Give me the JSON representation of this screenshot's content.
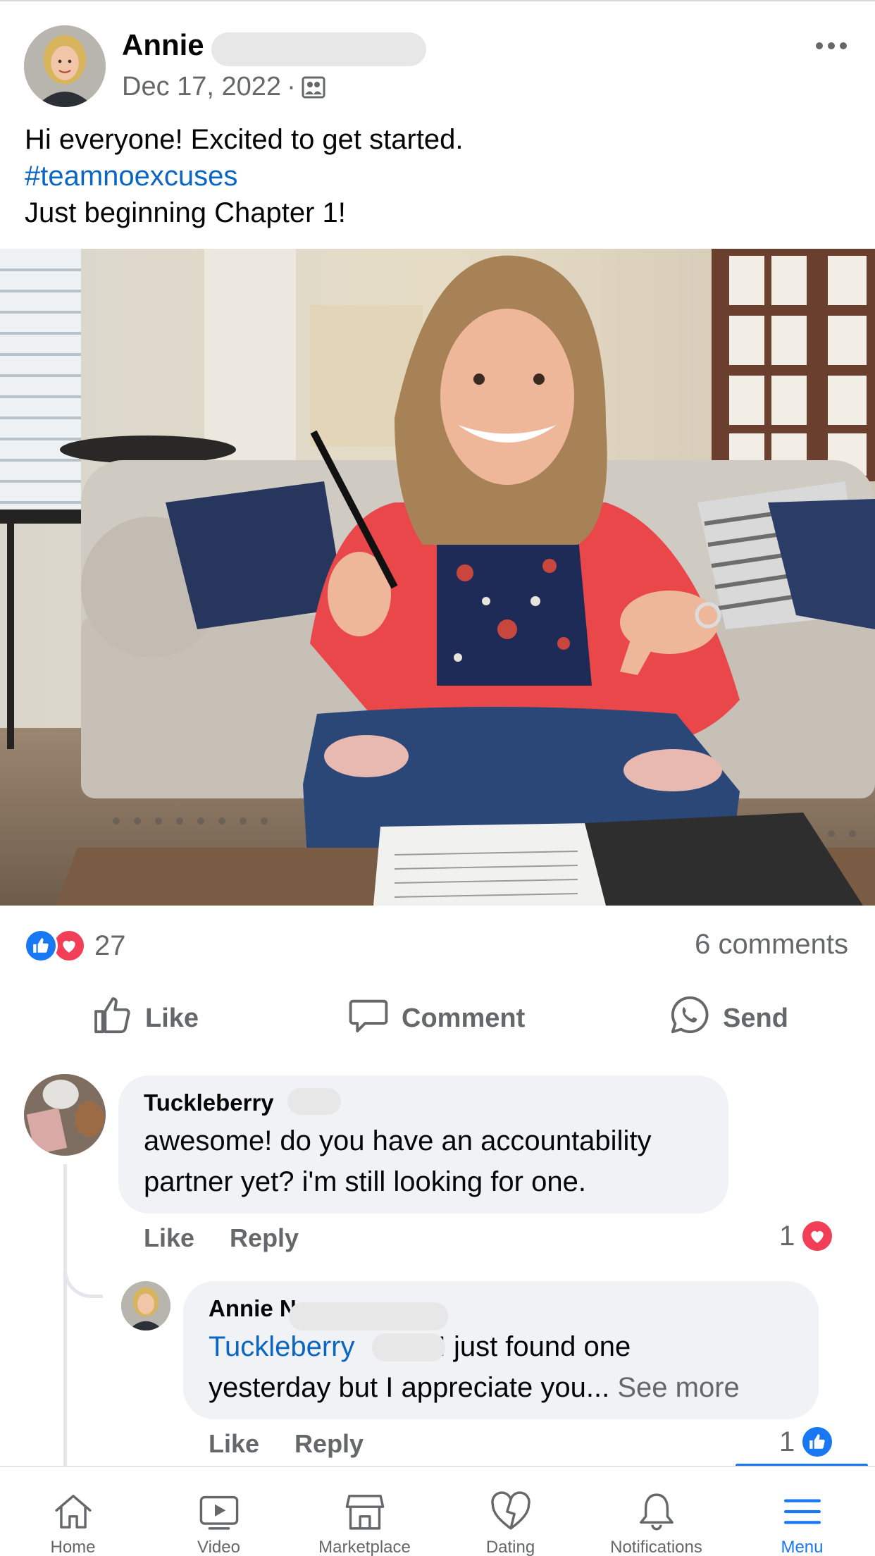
{
  "post": {
    "author": "Annie",
    "date": "Dec 17, 2022",
    "separator": "·",
    "audience_icon": "group-icon",
    "text_line1": "Hi everyone! Excited to get started.",
    "hashtag": "#teamnoexcuses",
    "text_line3": "Just beginning Chapter 1!",
    "reaction_count": "27",
    "comments_count": "6 comments",
    "more_icon": "more-options-icon"
  },
  "actions": {
    "like": "Like",
    "comment": "Comment",
    "send": "Send"
  },
  "comments": [
    {
      "name": "Tuckleberry",
      "text_line1": "awesome! do you have an accountability",
      "text_line2": "partner yet? i'm still looking for one.",
      "like": "Like",
      "reply": "Reply",
      "reaction_count": "1",
      "reaction_type": "love"
    },
    {
      "name": "Annie N",
      "mention": "Tuckleberry",
      "text_line1_rest": "I just found one",
      "text_line2": "yesterday but I appreciate you...",
      "see_more": "See more",
      "like": "Like",
      "reply": "Reply",
      "reaction_count": "1",
      "reaction_type": "like"
    }
  ],
  "nav": {
    "items": [
      {
        "label": "Home",
        "icon": "home-icon"
      },
      {
        "label": "Video",
        "icon": "video-icon"
      },
      {
        "label": "Marketplace",
        "icon": "marketplace-icon"
      },
      {
        "label": "Dating",
        "icon": "dating-icon"
      },
      {
        "label": "Notifications",
        "icon": "bell-icon"
      },
      {
        "label": "Menu",
        "icon": "menu-icon"
      }
    ],
    "active": "Menu"
  },
  "colors": {
    "accent": "#1877f2",
    "link": "#0a66c2",
    "love": "#f33e58",
    "secondary_text": "#65676b",
    "bubble": "#f0f2f5"
  }
}
